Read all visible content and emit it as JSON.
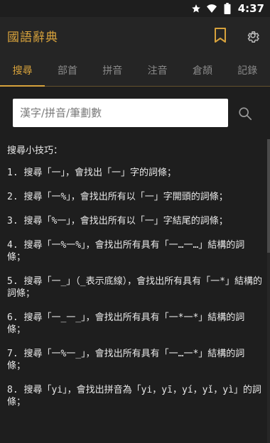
{
  "status": {
    "time": "4:37",
    "icons": [
      "star-icon",
      "wifi-icon",
      "battery-icon"
    ]
  },
  "app": {
    "title": "國語辭典",
    "actions": [
      "bookmark-icon",
      "settings-icon"
    ],
    "accent": "#d7a23c"
  },
  "tabs": [
    {
      "label": "搜尋",
      "active": true
    },
    {
      "label": "部首",
      "active": false
    },
    {
      "label": "拼音",
      "active": false
    },
    {
      "label": "注音",
      "active": false
    },
    {
      "label": "倉頡",
      "active": false
    },
    {
      "label": "記錄",
      "active": false
    }
  ],
  "search": {
    "placeholder": "漢字/拼音/筆劃數",
    "value": ""
  },
  "tips": {
    "title": "搜尋小技巧：",
    "items": [
      "1. 搜尋「一」，會找出「一」字的詞條；",
      "2. 搜尋「一%」，會找出所有以「一」字開頭的詞條；",
      "3. 搜尋「%一」，會找出所有以「一」字結尾的詞條；",
      "4. 搜尋「一%一%」，會找出所有具有「一…一…」結構的詞條；",
      "5. 搜尋「一_」（_表示底線），會找出所有具有「一*」結構的詞條；",
      "6. 搜尋「一_一_」，會找出所有具有「一*一*」結構的詞條；",
      "7. 搜尋「一%一_」，會找出所有具有「一…一*」結構的詞條；",
      "8. 搜尋「yi」，會找出拼音為「yi，yī，yí，yǐ，yì」的詞條；"
    ]
  }
}
